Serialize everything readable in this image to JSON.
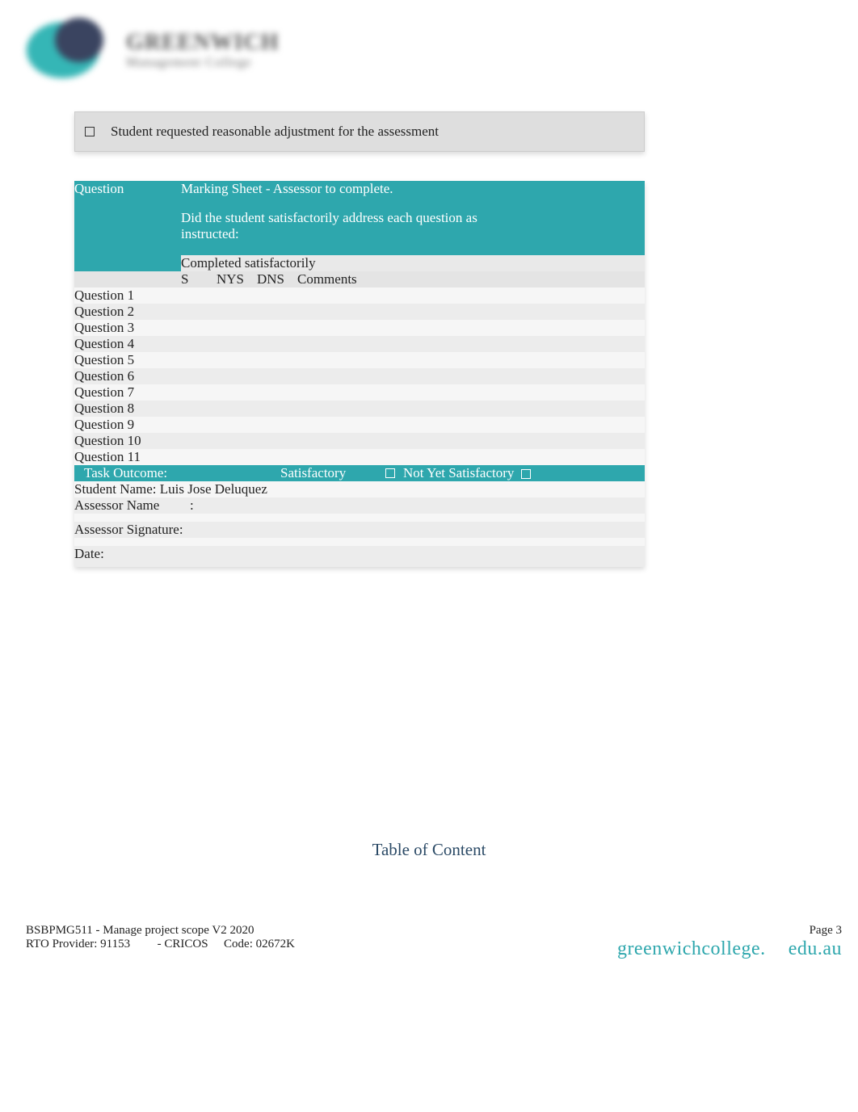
{
  "logo": {
    "line1": "GREENWICH",
    "line2": "Management College"
  },
  "adjustment": {
    "text": "Student requested reasonable adjustment for the assessment"
  },
  "marking": {
    "question_header": "Question",
    "title": "Marking Sheet - Assessor to complete.",
    "subtitle": "Did the student satisfactorily address each question as instructed:",
    "completed_label": "Completed satisfactorily",
    "cols": {
      "s": "S",
      "nys": "NYS",
      "dns": "DNS",
      "comments": "Comments"
    },
    "questions": [
      {
        "label": "Question 1"
      },
      {
        "label": "Question 2"
      },
      {
        "label": "Question 3"
      },
      {
        "label": "Question 4"
      },
      {
        "label": "Question 5"
      },
      {
        "label": "Question 6"
      },
      {
        "label": "Question 7"
      },
      {
        "label": "Question 8"
      },
      {
        "label": "Question 9"
      },
      {
        "label": "Question 10"
      },
      {
        "label": "Question 11"
      }
    ],
    "outcome": {
      "label": "Task Outcome:",
      "satisfactory": "Satisfactory",
      "not_yet": "Not Yet Satisfactory"
    },
    "student_name_label": "Student Name: ",
    "student_name_value": "Luis Jose Deluquez",
    "assessor_name_label": "Assessor Name",
    "assessor_colon": ":",
    "assessor_signature": "Assessor Signature:",
    "date_label": "Date:"
  },
  "toc": {
    "heading": "Table of Content"
  },
  "footer": {
    "line1": "BSBPMG511 - Manage project scope V2 2020",
    "line2a": "RTO Provider: 91153",
    "line2b": "- CRICOS",
    "line2c": "Code: 02672K",
    "page": "Page 3",
    "url1": "greenwichcollege.",
    "url2": "edu.au"
  }
}
